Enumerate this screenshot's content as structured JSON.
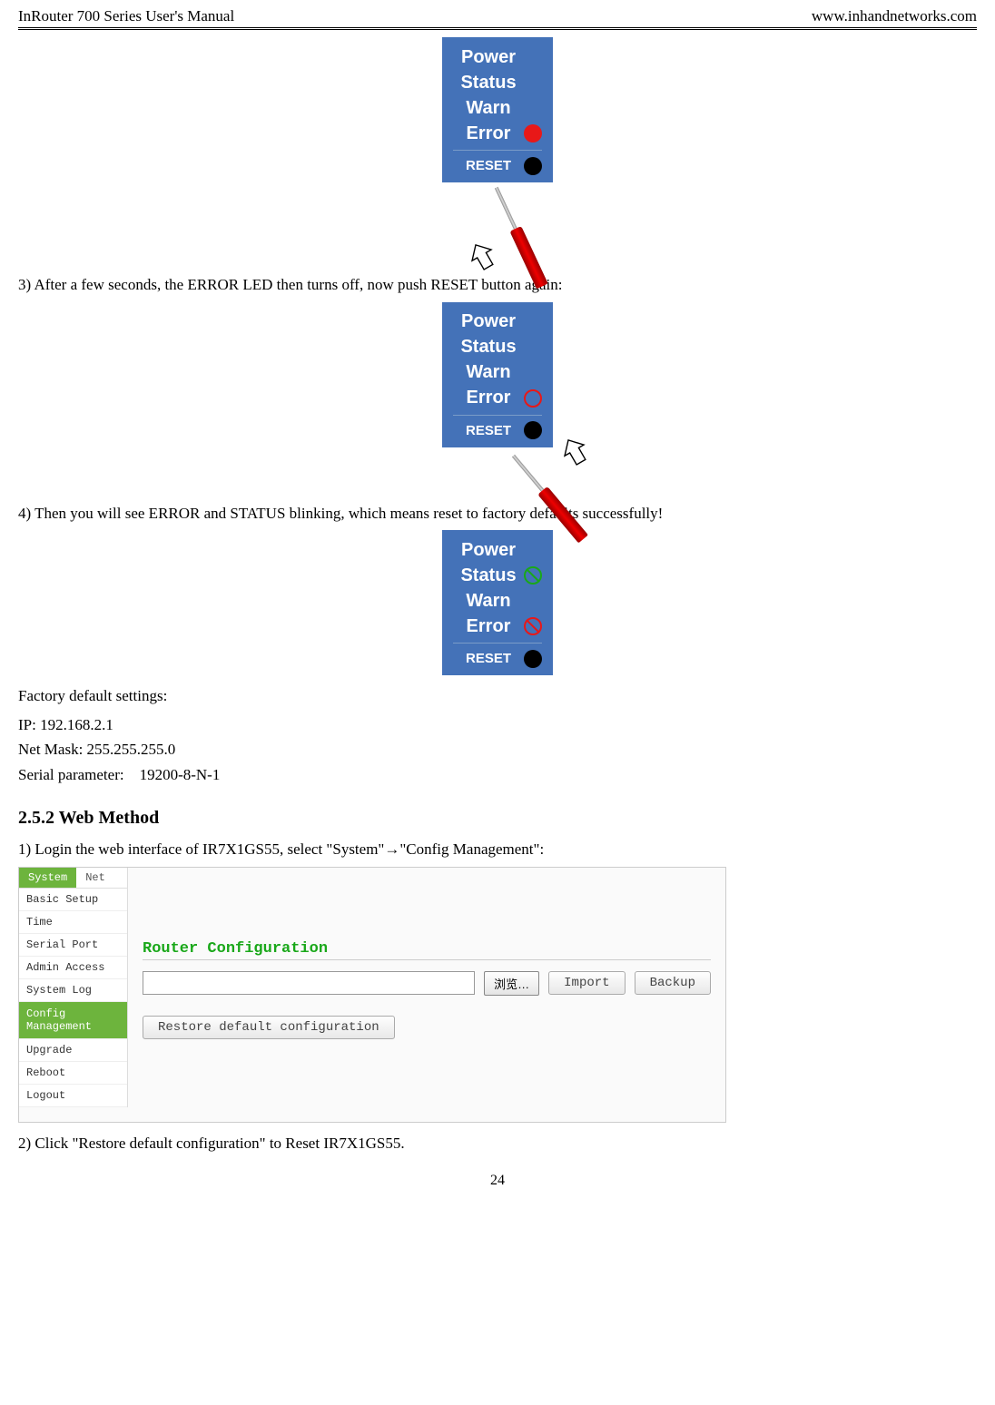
{
  "header": {
    "left": "InRouter 700 Series User's Manual",
    "right": "www.inhandnetworks.com"
  },
  "panel": {
    "power": "Power",
    "status": "Status",
    "warn": "Warn",
    "error": "Error",
    "reset": "RESET"
  },
  "text": {
    "step3": "3) After a few seconds, the ERROR LED then turns off, now push RESET button again:",
    "step4": "4) Then you will see ERROR and STATUS blinking, which means reset to factory defaults successfully!",
    "factory_head": "Factory default settings:",
    "ip": "IP: 192.168.2.1",
    "netmask": "Net Mask: 255.255.255.0",
    "serial": "Serial parameter:    19200-8-N-1",
    "section": "2.5.2 Web Method",
    "login": "1) Login the web interface of IR7X1GS55, select \"System\"→\"Config Management\":",
    "restore": "2) Click \"Restore default configuration\" to Reset IR7X1GS55."
  },
  "webui": {
    "tabs": {
      "system": "System",
      "net": "Net"
    },
    "sidebar": {
      "basic": "Basic Setup",
      "time": "Time",
      "serial": "Serial Port",
      "admin": "Admin Access",
      "syslog": "System Log",
      "config": "Config Management",
      "upgrade": "Upgrade",
      "reboot": "Reboot",
      "logout": "Logout"
    },
    "main": {
      "title": "Router Configuration",
      "browse": "浏览…",
      "import": "Import",
      "backup": "Backup",
      "restore": "Restore default configuration"
    }
  },
  "footer": {
    "page": "24"
  }
}
